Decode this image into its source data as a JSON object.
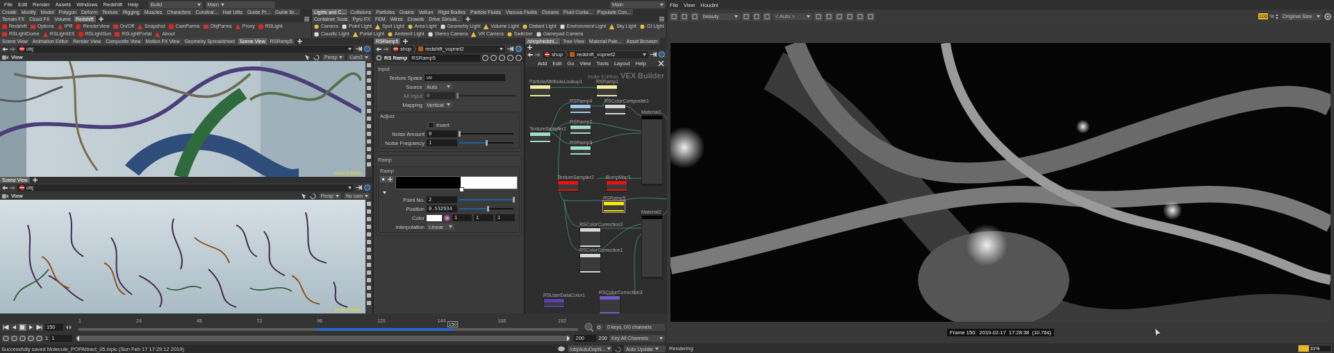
{
  "menu_bar": {
    "items": [
      "File",
      "Edit",
      "Render",
      "Assets",
      "Windows",
      "Redshift",
      "Help"
    ],
    "desktop": "Build",
    "context": "Main",
    "right_menu": "Main"
  },
  "shelves": [
    {
      "tabs": [
        {
          "label": "Create",
          "selected": false
        },
        {
          "label": "Modify",
          "selected": false
        },
        {
          "label": "Model",
          "selected": false
        },
        {
          "label": "Polygon",
          "selected": false
        },
        {
          "label": "Deform",
          "selected": false
        },
        {
          "label": "Texture",
          "selected": false
        },
        {
          "label": "Rigging",
          "selected": false
        },
        {
          "label": "Muscles",
          "selected": false
        },
        {
          "label": "Characters",
          "selected": false
        },
        {
          "label": "Constrai...",
          "selected": false
        },
        {
          "label": "Hair Utils",
          "selected": false
        },
        {
          "label": "Guide Pr...",
          "selected": false
        },
        {
          "label": "Guide Br...",
          "selected": false
        },
        {
          "label": "Terrain FX",
          "selected": false
        },
        {
          "label": "Cloud FX",
          "selected": false
        },
        {
          "label": "Volume",
          "selected": false
        },
        {
          "label": "Redshift",
          "selected": true
        }
      ],
      "tools": [
        "Redshift",
        "Options",
        "IPR",
        "RenderView",
        "On/Off",
        "Snapshot",
        "CamParms",
        "ObjParms",
        "Proxy",
        "RSLight",
        "RSLightDome",
        "RSLightIES",
        "RSLightSun",
        "RSLightPortal",
        "About"
      ]
    },
    {
      "tabs": [
        {
          "label": "Lights and C...",
          "selected": true
        },
        {
          "label": "Collisions",
          "selected": false
        },
        {
          "label": "Particles",
          "selected": false
        },
        {
          "label": "Grains",
          "selected": false
        },
        {
          "label": "Vellum",
          "selected": false
        },
        {
          "label": "Rigid Bodies",
          "selected": false
        },
        {
          "label": "Particle Fluids",
          "selected": false
        },
        {
          "label": "Viscous Fluids",
          "selected": false
        },
        {
          "label": "Oceans",
          "selected": false
        },
        {
          "label": "Fluid Conta...",
          "selected": false
        },
        {
          "label": "Populate Con...",
          "selected": false
        },
        {
          "label": "Container Tools",
          "selected": false
        },
        {
          "label": "Pyro FX",
          "selected": false
        },
        {
          "label": "FEM",
          "selected": false
        },
        {
          "label": "Wires",
          "selected": false
        },
        {
          "label": "Crowds",
          "selected": false
        },
        {
          "label": "Drive Simula...",
          "selected": false
        }
      ],
      "tools": [
        "Camera",
        "Point Light",
        "Spot Light",
        "Area Light",
        "Geometry Light",
        "Volume Light",
        "Distant Light",
        "Environment Light",
        "Sky Light",
        "GI Light",
        "Caustic Light",
        "Portal Light",
        "Ambient Light",
        "Stereo Camera",
        "VR Camera",
        "Switcher",
        "Gamepad Camera"
      ]
    }
  ],
  "scene_views": [
    {
      "tabs": [
        {
          "label": "Scene View",
          "selected": false
        },
        {
          "label": "Animation Editor",
          "selected": false
        },
        {
          "label": "Render View",
          "selected": false
        },
        {
          "label": "Composite View",
          "selected": false
        },
        {
          "label": "Motion FX View",
          "selected": false
        },
        {
          "label": "Geometry Spreadsheet",
          "selected": false
        },
        {
          "label": "Scene View",
          "selected": true
        },
        {
          "label": "RSRamp5",
          "selected": false
        }
      ],
      "path": "obj",
      "title": "View",
      "projection": "Persp",
      "camera": "Cam2",
      "edition": "Indie Edition"
    },
    {
      "tabs": [
        {
          "label": "Scene View",
          "selected": true
        }
      ],
      "path": "obj",
      "title": "View",
      "projection": "Persp",
      "camera": "No cam",
      "edition": "Indie Edition"
    }
  ],
  "parameters": {
    "tabs": [
      {
        "label": "RSRamp5",
        "selected": true
      }
    ],
    "path": [
      "shop",
      "redshift_vopnet2"
    ],
    "node_type": "RS Ramp",
    "node_name": "RSRamp5",
    "sections": [
      {
        "title": "Input",
        "rows": [
          {
            "kind": "text",
            "label": "Texture Space",
            "value": "uv",
            "disabled": false
          },
          {
            "kind": "menu",
            "label": "Source",
            "value": "Auto",
            "disabled": false
          },
          {
            "kind": "slider",
            "label": "Alt Input",
            "value": "0",
            "level": 0,
            "disabled": true
          },
          {
            "kind": "menu",
            "label": "Mapping",
            "value": "Vertical",
            "disabled": false
          }
        ]
      },
      {
        "title": "Adjust",
        "rows": [
          {
            "kind": "checkbox",
            "label": "Invert",
            "checked": false,
            "disabled": false
          },
          {
            "kind": "slider",
            "label": "Noise Amount",
            "value": "0",
            "level": 0,
            "disabled": false
          },
          {
            "kind": "slider",
            "label": "Noise Frequency",
            "value": "1",
            "level": 0.5,
            "disabled": false
          }
        ]
      }
    ],
    "ramp": {
      "title": "Ramp",
      "label": "Ramp",
      "marker": {
        "level": 0.533
      },
      "rows": [
        {
          "kind": "slider",
          "label": "Point No.",
          "value": "2",
          "level": 1,
          "disabled": false
        },
        {
          "kind": "slider",
          "label": "Position",
          "value": "0.532934",
          "level": 0.53,
          "disabled": false
        },
        {
          "kind": "color",
          "label": "Color",
          "values": [
            "1",
            "1",
            "1"
          ],
          "disabled": false
        },
        {
          "kind": "menu",
          "label": "Interpolation",
          "value": "Linear",
          "disabled": false
        }
      ]
    }
  },
  "network": {
    "tabs": [
      {
        "label": "/shop/redshi...",
        "selected": true
      },
      {
        "label": "Tree View",
        "selected": false
      },
      {
        "label": "Material Pale...",
        "selected": false
      },
      {
        "label": "Asset Browser",
        "selected": false
      }
    ],
    "path": [
      "shop",
      "redshift_vopnet2"
    ],
    "menu": [
      "Add",
      "Edit",
      "Go",
      "View",
      "Tools",
      "Layout",
      "Help"
    ],
    "edition": "Indie Edition",
    "title": "VEX Builder",
    "nodes": [
      {
        "name": "ParticleAttributeLookup1",
        "color": "#f5eea0",
        "selected": false
      },
      {
        "name": "RSRamp1",
        "color": "#f5eea0",
        "selected": false
      },
      {
        "name": "RSRamp4",
        "color": "#9cc8ee",
        "selected": false
      },
      {
        "name": "RSColorComposite1",
        "color": "#d8d8d8",
        "selected": false
      },
      {
        "name": "RSRamp2",
        "color": "#9ee0c8",
        "selected": false
      },
      {
        "name": "TextureSampler1",
        "color": "#9ee0c8",
        "selected": false
      },
      {
        "name": "RSRamp3",
        "color": "#9ee0c8",
        "selected": false
      },
      {
        "name": "Material1",
        "color": "#050505",
        "selected": false
      },
      {
        "name": "TextureSampler2",
        "color": "#ee1010",
        "selected": false
      },
      {
        "name": "BumpMap1",
        "color": "#ee1010",
        "selected": false
      },
      {
        "name": "RSRamp5",
        "color": "#f0e800",
        "selected": true
      },
      {
        "name": "Material2",
        "color": "#050505",
        "selected": false
      },
      {
        "name": "RSColorCorrection2",
        "color": "#d8d8d8",
        "selected": false
      },
      {
        "name": "RSColorCorrection1",
        "color": "#d8d8d8",
        "selected": false
      },
      {
        "name": "RSUserDataColor1",
        "color": "#5a40b0",
        "selected": false
      },
      {
        "name": "RSColorCorrection3",
        "color": "#7858d0",
        "selected": false
      }
    ]
  },
  "timeline": {
    "frame": "150",
    "ticks": [
      "1",
      "24",
      "48",
      "72",
      "96",
      "120",
      "144",
      "168",
      "192"
    ],
    "playhead": {
      "label": "150",
      "level": 0.749
    },
    "range": {
      "level": 1
    },
    "start": "1",
    "start_field": "1",
    "end": "200",
    "end_field": "200",
    "keys": "0 keys, 0/0 channels",
    "key_all": "Key All Channels"
  },
  "status_bar": {
    "message": "Successfully saved Molecule_POPAttract_05.hiplc (Sun Feb 17 17:29:12 2019)",
    "path": "/obj/AutoDopN...",
    "update": "Auto Update"
  },
  "render_view": {
    "menu": [
      "File",
      "View",
      "Houdini"
    ],
    "aov": "beauty",
    "camera": "< Auto >",
    "zoom": "100",
    "zoom_unit": "%",
    "size": "Original Size",
    "frame_info": "Frame 150:  2019-02-17  17:28:38  (10.76s)",
    "status": "Rendering",
    "progress": {
      "label": "31%",
      "level": 0.31
    }
  }
}
